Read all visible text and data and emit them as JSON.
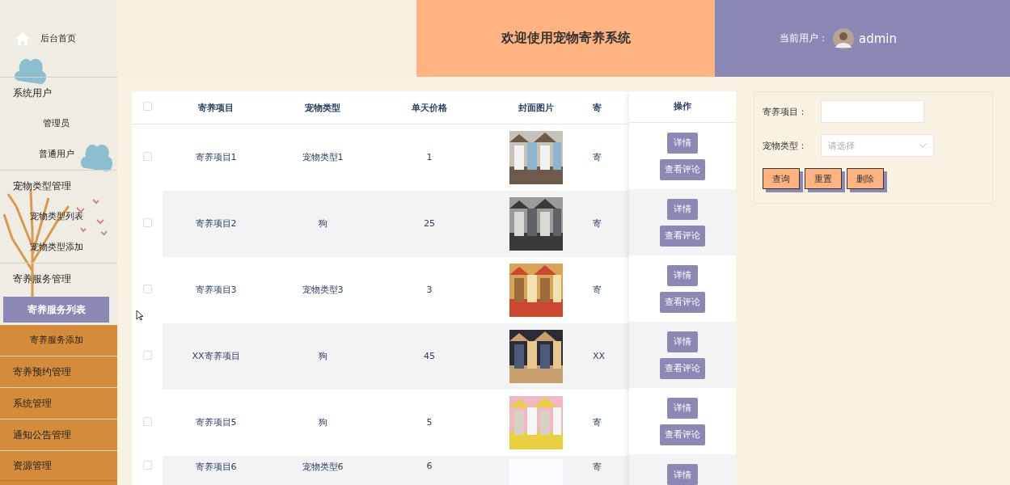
{
  "sidebar": {
    "items": [
      {
        "kind": "home",
        "label": "后台首页"
      },
      {
        "kind": "group",
        "label": "系统用户",
        "children": [
          {
            "label": "管理员",
            "selected": false
          },
          {
            "label": "普通用户",
            "selected": false
          }
        ]
      },
      {
        "kind": "group",
        "label": "宠物类型管理",
        "children": [
          {
            "label": "宠物类型列表",
            "selected": false
          },
          {
            "label": "宠物类型添加",
            "selected": false
          }
        ]
      },
      {
        "kind": "group",
        "label": "寄养服务管理",
        "children": [
          {
            "label": "寄养服务列表",
            "selected": true
          },
          {
            "label": "寄养服务添加",
            "selected": false
          }
        ]
      },
      {
        "kind": "group",
        "label": "寄养预约管理"
      },
      {
        "kind": "group",
        "label": "系统管理"
      },
      {
        "kind": "group",
        "label": "通知公告管理"
      },
      {
        "kind": "group",
        "label": "资源管理"
      }
    ]
  },
  "header": {
    "title": "欢迎使用宠物寄养系统",
    "user_label": "当前用户：",
    "username": "admin"
  },
  "table": {
    "columns": [
      {
        "label": "寄养项目"
      },
      {
        "label": "宠物类型"
      },
      {
        "label": "单天价格"
      },
      {
        "label": "封面图片"
      },
      {
        "label": "寄"
      },
      {
        "label": "操作"
      }
    ],
    "header_checked": false,
    "rows": [
      {
        "checked": false,
        "cells": [
          "寄养项目1",
          "宠物类型1",
          "1"
        ],
        "image": {
          "kind": "picture"
        },
        "column_5": "寄",
        "actions": [
          "详情",
          "查看评论"
        ]
      },
      {
        "checked": false,
        "cells": [
          "寄养项目2",
          "狗",
          "25"
        ],
        "image": {
          "kind": "picture"
        },
        "column_5": "寄",
        "actions": [
          "详情",
          "查看评论"
        ]
      },
      {
        "checked": false,
        "cells": [
          "寄养项目3",
          "宠物类型3",
          "3"
        ],
        "image": {
          "kind": "picture"
        },
        "column_5": "寄",
        "actions": [
          "详情",
          "查看评论"
        ]
      },
      {
        "checked": false,
        "cells": [
          "XX寄养项目",
          "狗",
          "45"
        ],
        "image": {
          "kind": "picture"
        },
        "column_5": "XX",
        "actions": [
          "详情",
          "查看评论"
        ]
      },
      {
        "checked": false,
        "cells": [
          "寄养项目5",
          "狗",
          "5"
        ],
        "image": {
          "kind": "picture"
        },
        "column_5": "寄",
        "actions": [
          "详情",
          "查看评论"
        ]
      },
      {
        "checked": false,
        "cells": [
          "寄养项目6",
          "宠物类型6",
          "6"
        ],
        "image": {
          "kind": "blank"
        },
        "column_5": "寄",
        "actions": [
          "详情"
        ]
      }
    ]
  },
  "search": {
    "fields": [
      {
        "kind": "text",
        "label": "寄养项目："
      },
      {
        "kind": "select",
        "label": "宠物类型：",
        "placeholder": "请选择"
      }
    ],
    "buttons": [
      "查询",
      "重置",
      "删除"
    ]
  }
}
